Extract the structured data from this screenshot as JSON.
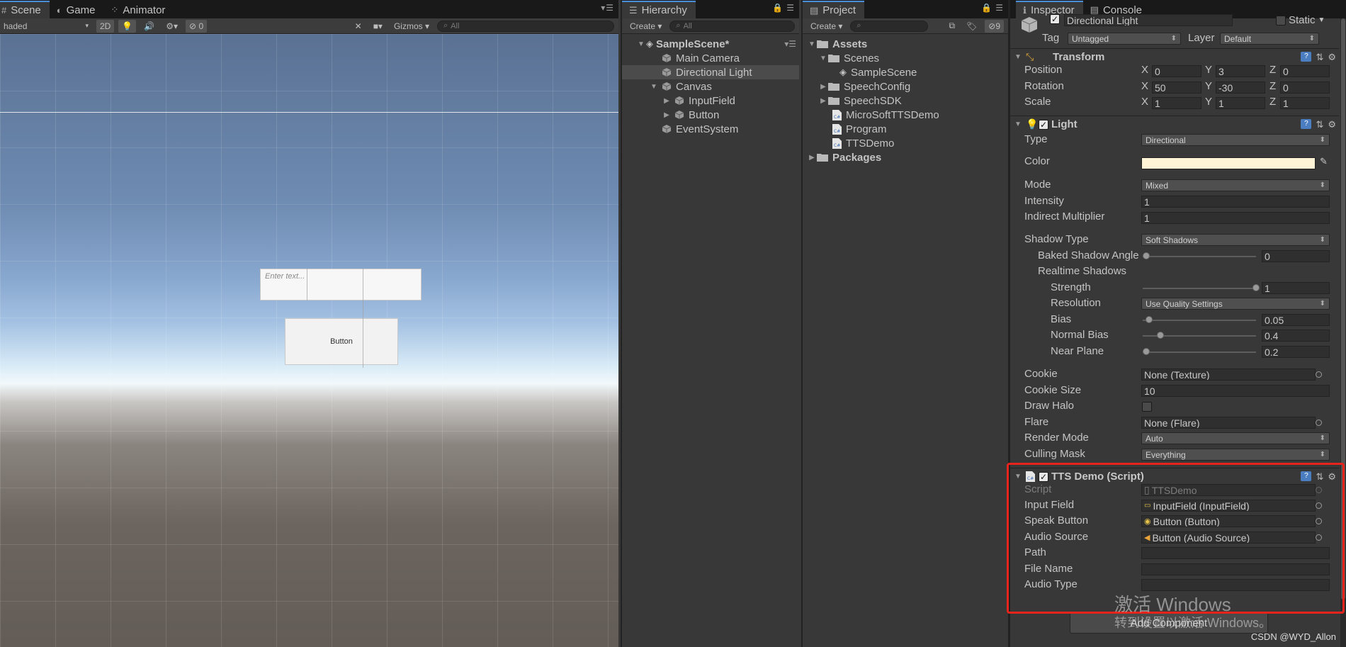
{
  "scene": {
    "tabs": [
      {
        "label": "Scene",
        "icon": "scene-icon"
      },
      {
        "label": "Game",
        "icon": "game-icon"
      },
      {
        "label": "Animator",
        "icon": "animator-icon"
      }
    ],
    "shading_mode": "haded",
    "mode_2d": "2D",
    "effects_count": "0",
    "gizmos_label": "Gizmos",
    "search_placeholder": "All",
    "input_placeholder": "Enter text...",
    "button_label": "Button"
  },
  "hierarchy": {
    "tab_label": "Hierarchy",
    "create_label": "Create",
    "search_placeholder": "All",
    "scene_name": "SampleScene*",
    "items": [
      {
        "label": "Main Camera",
        "depth": 1
      },
      {
        "label": "Directional Light",
        "depth": 1,
        "selected": true
      },
      {
        "label": "Canvas",
        "depth": 1,
        "expanded": true
      },
      {
        "label": "InputField",
        "depth": 2
      },
      {
        "label": "Button",
        "depth": 2
      },
      {
        "label": "EventSystem",
        "depth": 1
      }
    ]
  },
  "project": {
    "tab_label": "Project",
    "create_label": "Create",
    "hidden_count": "9",
    "items": [
      {
        "label": "Assets",
        "type": "folder",
        "depth": 0,
        "bold": true
      },
      {
        "label": "Scenes",
        "type": "folder",
        "depth": 1
      },
      {
        "label": "SampleScene",
        "type": "scene",
        "depth": 2
      },
      {
        "label": "SpeechConfig",
        "type": "folder",
        "depth": 1
      },
      {
        "label": "SpeechSDK",
        "type": "folder",
        "depth": 1
      },
      {
        "label": "MicroSoftTTSDemo",
        "type": "cs",
        "depth": 1
      },
      {
        "label": "Program",
        "type": "cs",
        "depth": 1
      },
      {
        "label": "TTSDemo",
        "type": "cs",
        "depth": 1
      },
      {
        "label": "Packages",
        "type": "folder",
        "depth": 0,
        "bold": true
      }
    ]
  },
  "inspector": {
    "tabs": {
      "inspector": "Inspector",
      "console": "Console"
    },
    "object_name": "Directional Light",
    "static_label": "Static",
    "tag_label": "Tag",
    "tag_value": "Untagged",
    "layer_label": "Layer",
    "layer_value": "Default",
    "transform": {
      "title": "Transform",
      "position_label": "Position",
      "position": {
        "x": "0",
        "y": "3",
        "z": "0"
      },
      "rotation_label": "Rotation",
      "rotation": {
        "x": "50",
        "y": "-30",
        "z": "0"
      },
      "scale_label": "Scale",
      "scale": {
        "x": "1",
        "y": "1",
        "z": "1"
      }
    },
    "light": {
      "title": "Light",
      "type_label": "Type",
      "type_value": "Directional",
      "color_label": "Color",
      "color_value": "#fff4d6",
      "mode_label": "Mode",
      "mode_value": "Mixed",
      "intensity_label": "Intensity",
      "intensity_value": "1",
      "indirect_label": "Indirect Multiplier",
      "indirect_value": "1",
      "shadow_type_label": "Shadow Type",
      "shadow_type_value": "Soft Shadows",
      "baked_angle_label": "Baked Shadow Angle",
      "baked_angle_value": "0",
      "baked_angle_level": 0,
      "realtime_label": "Realtime Shadows",
      "strength_label": "Strength",
      "strength_value": "1",
      "strength_level": 1,
      "resolution_label": "Resolution",
      "resolution_value": "Use Quality Settings",
      "bias_label": "Bias",
      "bias_value": "0.05",
      "bias_level": 0.025,
      "normal_bias_label": "Normal Bias",
      "normal_bias_value": "0.4",
      "normal_bias_level": 0.13,
      "near_plane_label": "Near Plane",
      "near_plane_value": "0.2",
      "near_plane_level": 0,
      "cookie_label": "Cookie",
      "cookie_value": "None (Texture)",
      "cookie_size_label": "Cookie Size",
      "cookie_size_value": "10",
      "draw_halo_label": "Draw Halo",
      "flare_label": "Flare",
      "flare_value": "None (Flare)",
      "render_mode_label": "Render Mode",
      "render_mode_value": "Auto",
      "culling_label": "Culling Mask",
      "culling_value": "Everything"
    },
    "tts": {
      "title": "TTS Demo (Script)",
      "script_label": "Script",
      "script_value": "TTSDemo",
      "input_label": "Input Field",
      "input_value": "InputField (InputField)",
      "speak_label": "Speak Button",
      "speak_value": "Button (Button)",
      "audio_label": "Audio Source",
      "audio_value": "Button (Audio Source)",
      "path_label": "Path",
      "path_value": "",
      "file_label": "File Name",
      "file_value": "",
      "audio_type_label": "Audio Type",
      "audio_type_value": ""
    },
    "add_component": "Add Component"
  },
  "watermark": {
    "line1": "激活 Windows",
    "line2": "转到设置以激活 Windows。"
  },
  "credit": "CSDN @WYD_Allon",
  "colors": {
    "accent": "#4a90d9",
    "highlight_box": "#e8231c",
    "panel_bg": "#383838"
  }
}
